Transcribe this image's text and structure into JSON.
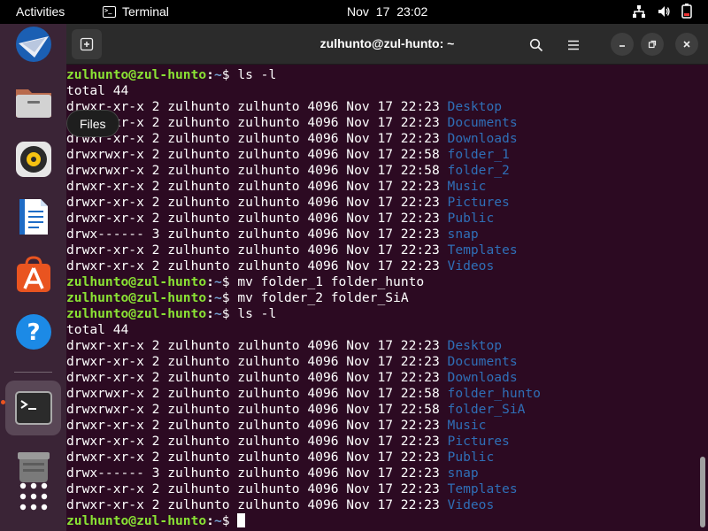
{
  "topbar": {
    "activities": "Activities",
    "app_name": "Terminal",
    "clock": "Nov 17  23:02",
    "tray_icons": [
      "network-icon",
      "volume-icon",
      "battery-icon"
    ]
  },
  "dock": {
    "tooltip": "Files",
    "items": [
      "thunderbird-icon",
      "files-icon",
      "rhythmbox-icon",
      "writer-icon",
      "app-center-icon",
      "help-icon",
      "terminal-icon",
      "trash-icon",
      "apps-grid-icon"
    ]
  },
  "window": {
    "title": "zulhunto@zul-hunto: ~"
  },
  "terminal": {
    "prompt_user": "zulhunto@zul-hunto",
    "prompt_path": "~",
    "lines": [
      {
        "kind": "prompt",
        "cmd": "ls -l"
      },
      {
        "kind": "text",
        "text": "total 44"
      },
      {
        "kind": "entry",
        "meta": "drwxr-xr-x 2 zulhunto zulhunto 4096 Nov 17 22:23 ",
        "name": "Desktop"
      },
      {
        "kind": "entry",
        "meta": "drwxr-xr-x 2 zulhunto zulhunto 4096 Nov 17 22:23 ",
        "name": "Documents"
      },
      {
        "kind": "entry",
        "meta": "drwxr-xr-x 2 zulhunto zulhunto 4096 Nov 17 22:23 ",
        "name": "Downloads"
      },
      {
        "kind": "entry",
        "meta": "drwxrwxr-x 2 zulhunto zulhunto 4096 Nov 17 22:58 ",
        "name": "folder_1"
      },
      {
        "kind": "entry",
        "meta": "drwxrwxr-x 2 zulhunto zulhunto 4096 Nov 17 22:58 ",
        "name": "folder_2"
      },
      {
        "kind": "entry",
        "meta": "drwxr-xr-x 2 zulhunto zulhunto 4096 Nov 17 22:23 ",
        "name": "Music"
      },
      {
        "kind": "entry",
        "meta": "drwxr-xr-x 2 zulhunto zulhunto 4096 Nov 17 22:23 ",
        "name": "Pictures"
      },
      {
        "kind": "entry",
        "meta": "drwxr-xr-x 2 zulhunto zulhunto 4096 Nov 17 22:23 ",
        "name": "Public"
      },
      {
        "kind": "entry",
        "meta": "drwx------ 3 zulhunto zulhunto 4096 Nov 17 22:23 ",
        "name": "snap"
      },
      {
        "kind": "entry",
        "meta": "drwxr-xr-x 2 zulhunto zulhunto 4096 Nov 17 22:23 ",
        "name": "Templates"
      },
      {
        "kind": "entry",
        "meta": "drwxr-xr-x 2 zulhunto zulhunto 4096 Nov 17 22:23 ",
        "name": "Videos"
      },
      {
        "kind": "prompt",
        "cmd": "mv folder_1 folder_hunto"
      },
      {
        "kind": "prompt",
        "cmd": "mv folder_2 folder_SiA"
      },
      {
        "kind": "prompt",
        "cmd": "ls -l"
      },
      {
        "kind": "text",
        "text": "total 44"
      },
      {
        "kind": "entry",
        "meta": "drwxr-xr-x 2 zulhunto zulhunto 4096 Nov 17 22:23 ",
        "name": "Desktop"
      },
      {
        "kind": "entry",
        "meta": "drwxr-xr-x 2 zulhunto zulhunto 4096 Nov 17 22:23 ",
        "name": "Documents"
      },
      {
        "kind": "entry",
        "meta": "drwxr-xr-x 2 zulhunto zulhunto 4096 Nov 17 22:23 ",
        "name": "Downloads"
      },
      {
        "kind": "entry",
        "meta": "drwxrwxr-x 2 zulhunto zulhunto 4096 Nov 17 22:58 ",
        "name": "folder_hunto"
      },
      {
        "kind": "entry",
        "meta": "drwxrwxr-x 2 zulhunto zulhunto 4096 Nov 17 22:58 ",
        "name": "folder_SiA"
      },
      {
        "kind": "entry",
        "meta": "drwxr-xr-x 2 zulhunto zulhunto 4096 Nov 17 22:23 ",
        "name": "Music"
      },
      {
        "kind": "entry",
        "meta": "drwxr-xr-x 2 zulhunto zulhunto 4096 Nov 17 22:23 ",
        "name": "Pictures"
      },
      {
        "kind": "entry",
        "meta": "drwxr-xr-x 2 zulhunto zulhunto 4096 Nov 17 22:23 ",
        "name": "Public"
      },
      {
        "kind": "entry",
        "meta": "drwx------ 3 zulhunto zulhunto 4096 Nov 17 22:23 ",
        "name": "snap"
      },
      {
        "kind": "entry",
        "meta": "drwxr-xr-x 2 zulhunto zulhunto 4096 Nov 17 22:23 ",
        "name": "Templates"
      },
      {
        "kind": "entry",
        "meta": "drwxr-xr-x 2 zulhunto zulhunto 4096 Nov 17 22:23 ",
        "name": "Videos"
      },
      {
        "kind": "prompt",
        "cmd": ""
      }
    ]
  },
  "colors": {
    "accent": "#e95420",
    "terminal_bg": "#2c0a22",
    "prompt_user": "#8ae234",
    "prompt_path": "#729fcf",
    "directory": "#2f6fb7"
  }
}
